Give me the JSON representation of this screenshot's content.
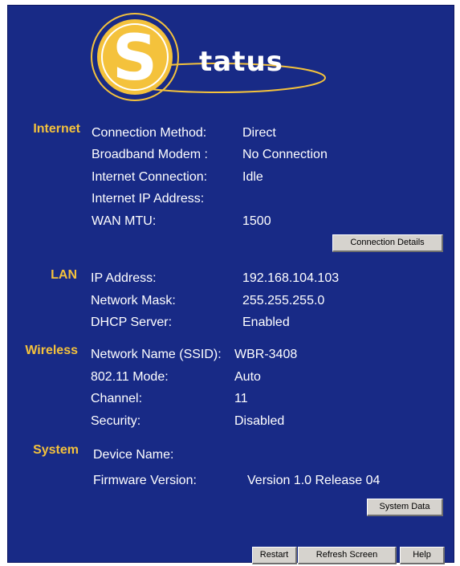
{
  "logo": {
    "letter": "S",
    "text": "tatus"
  },
  "internet": {
    "heading": "Internet",
    "rows": [
      {
        "label": "Connection Method:",
        "value": "Direct"
      },
      {
        "label": "Broadband Modem :",
        "value": "No Connection"
      },
      {
        "label": "Internet Connection:",
        "value": "Idle"
      },
      {
        "label": "Internet IP Address:",
        "value": ""
      },
      {
        "label": "WAN MTU:",
        "value": "1500"
      }
    ],
    "details_button": "Connection Details"
  },
  "lan": {
    "heading": "LAN",
    "rows": [
      {
        "label": "IP Address:",
        "value": "192.168.104.103"
      },
      {
        "label": "Network Mask:",
        "value": "255.255.255.0"
      },
      {
        "label": "DHCP Server:",
        "value": "Enabled"
      }
    ]
  },
  "wireless": {
    "heading": "Wireless",
    "rows": [
      {
        "label": "Network Name (SSID):",
        "value": "WBR-3408"
      },
      {
        "label": "802.11 Mode:",
        "value": "Auto"
      },
      {
        "label": "Channel:",
        "value": "11"
      },
      {
        "label": "Security:",
        "value": "Disabled"
      }
    ]
  },
  "system": {
    "heading": "System",
    "rows": [
      {
        "label": "Device Name:",
        "value": ""
      },
      {
        "label": "Firmware Version:",
        "value": "Version 1.0 Release 04"
      }
    ],
    "data_button": "System Data"
  },
  "footer": {
    "restart": "Restart",
    "refresh": "Refresh Screen",
    "help": "Help"
  },
  "colors": {
    "panel": "#182a86",
    "accent": "#f4c23c",
    "text": "#ffffff",
    "button": "#d6d3ce"
  }
}
